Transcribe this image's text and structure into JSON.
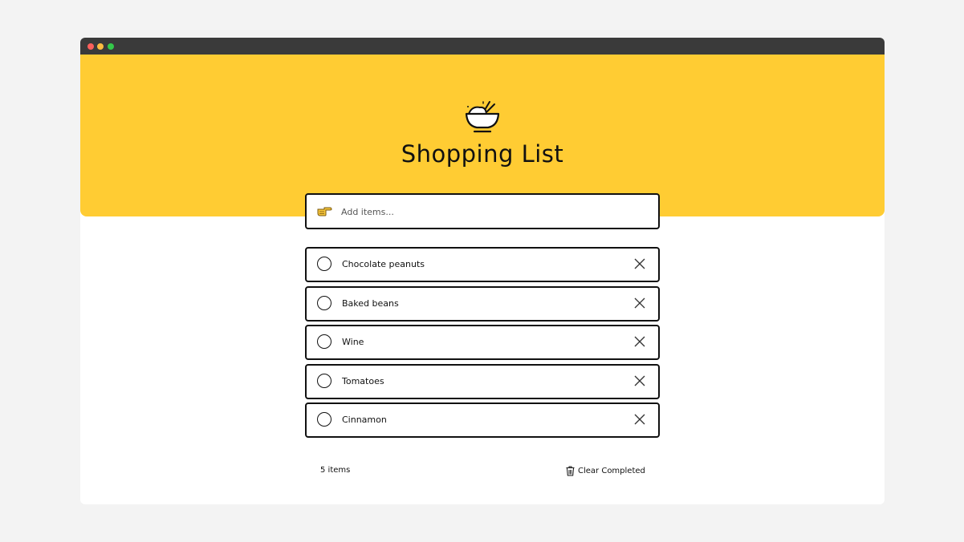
{
  "app": {
    "title": "Shopping List"
  },
  "colors": {
    "accent": "#ffcc33",
    "titlebar": "#3a3a3a",
    "border": "#111111"
  },
  "add": {
    "placeholder": "Add items...",
    "icon": "pointing-hand-icon"
  },
  "items": [
    {
      "label": "Chocolate peanuts",
      "completed": false
    },
    {
      "label": "Baked beans",
      "completed": false
    },
    {
      "label": "Wine",
      "completed": false
    },
    {
      "label": "Tomatoes",
      "completed": false
    },
    {
      "label": "Cinnamon",
      "completed": false
    }
  ],
  "footer": {
    "count_label": "5 items",
    "clear_label": "Clear Completed"
  }
}
